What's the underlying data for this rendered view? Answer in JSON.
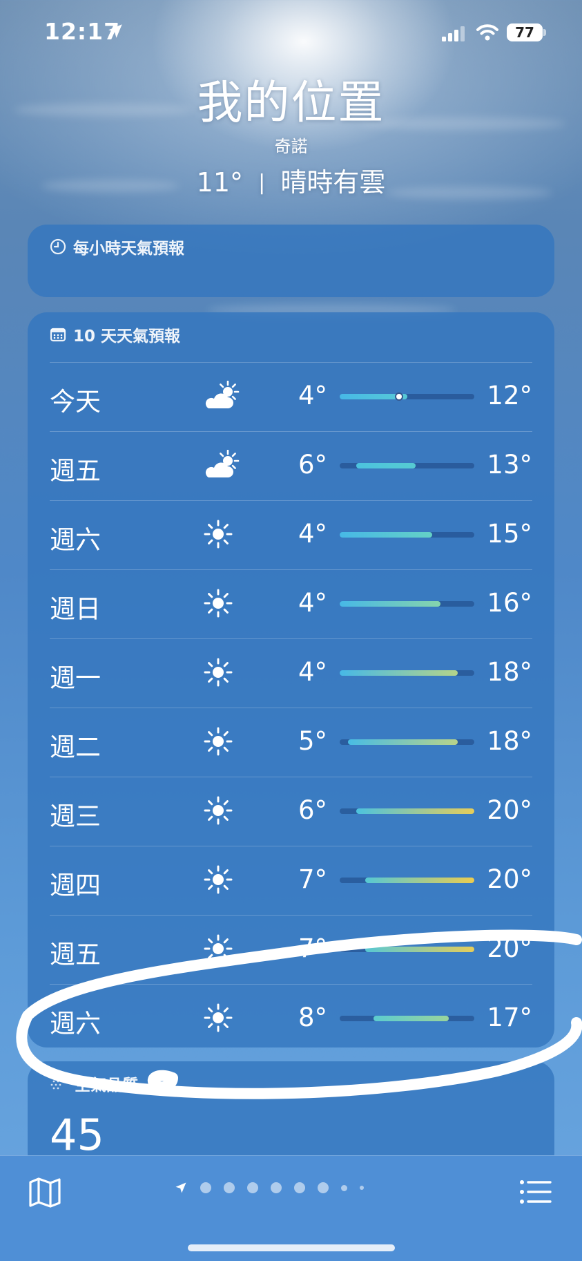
{
  "status": {
    "time": "12:17",
    "battery": "77"
  },
  "header": {
    "title": "我的位置",
    "city": "奇諾",
    "temp": "11°",
    "separator": "|",
    "condition": "晴時有雲"
  },
  "hourly": {
    "label": "每小時天氣預報"
  },
  "daily": {
    "label": "10 天天氣預報",
    "range_min": 4,
    "range_max": 20,
    "current": 11,
    "rows": [
      {
        "day": "今天",
        "icon": "partly-cloudy-icon",
        "lo": "4°",
        "hi": "12°",
        "lo_v": 4,
        "hi_v": 12,
        "c1": "#47b8e6",
        "c2": "#57c9d6"
      },
      {
        "day": "週五",
        "icon": "partly-cloudy-icon",
        "lo": "6°",
        "hi": "13°",
        "lo_v": 6,
        "hi_v": 13,
        "c1": "#4cc2de",
        "c2": "#56cbd2"
      },
      {
        "day": "週六",
        "icon": "sun-icon",
        "lo": "4°",
        "hi": "15°",
        "lo_v": 4,
        "hi_v": 15,
        "c1": "#47b8e6",
        "c2": "#64d1c6"
      },
      {
        "day": "週日",
        "icon": "sun-icon",
        "lo": "4°",
        "hi": "16°",
        "lo_v": 4,
        "hi_v": 16,
        "c1": "#47b8e6",
        "c2": "#86d4ac"
      },
      {
        "day": "週一",
        "icon": "sun-icon",
        "lo": "4°",
        "hi": "18°",
        "lo_v": 4,
        "hi_v": 18,
        "c1": "#47b8e6",
        "c2": "#b4d48a"
      },
      {
        "day": "週二",
        "icon": "sun-icon",
        "lo": "5°",
        "hi": "18°",
        "lo_v": 5,
        "hi_v": 18,
        "c1": "#48bce4",
        "c2": "#b8d38a"
      },
      {
        "day": "週三",
        "icon": "sun-icon",
        "lo": "6°",
        "hi": "20°",
        "lo_v": 6,
        "hi_v": 20,
        "c1": "#4cc2de",
        "c2": "#e6cd5a"
      },
      {
        "day": "週四",
        "icon": "sun-icon",
        "lo": "7°",
        "hi": "20°",
        "lo_v": 7,
        "hi_v": 20,
        "c1": "#56c8d4",
        "c2": "#ebcc50"
      },
      {
        "day": "週五",
        "icon": "sun-icon",
        "lo": "7°",
        "hi": "20°",
        "lo_v": 7,
        "hi_v": 20,
        "c1": "#56c8d4",
        "c2": "#e6cd5a"
      },
      {
        "day": "週六",
        "icon": "sun-icon",
        "lo": "8°",
        "hi": "17°",
        "lo_v": 8,
        "hi_v": 17,
        "c1": "#5ccccf",
        "c2": "#9ad49c"
      }
    ]
  },
  "air_quality": {
    "label": "空氣品質",
    "value": "45"
  },
  "bottom": {
    "pages": 9
  },
  "annotation": {
    "color": "#ffffff",
    "circled_row": "週六"
  }
}
